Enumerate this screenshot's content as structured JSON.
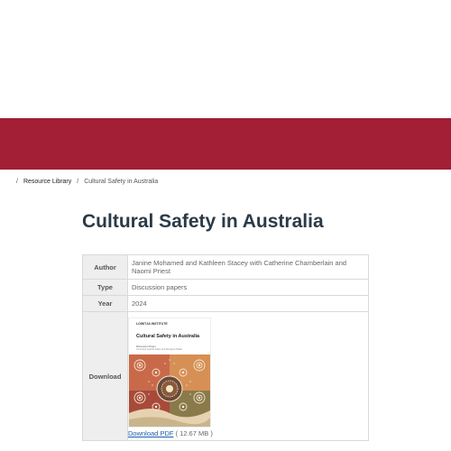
{
  "breadcrumb": {
    "separator": "/",
    "items": [
      "Resource Library",
      "Cultural Safety in Australia"
    ]
  },
  "page_title": "Cultural Safety in Australia",
  "details": {
    "author_label": "Author",
    "author_value": "Janine Mohamed and Kathleen Stacey with Catherine Chamberlain and Naomi Priest",
    "type_label": "Type",
    "type_value": "Discussion papers",
    "year_label": "Year",
    "year_value": "2024",
    "download_label": "Download",
    "cover": {
      "logo_text": "LOWITJA INSTITUTE",
      "title": "Cultural Safety in Australia",
      "subtitle": "Discussion Paper",
      "subtitle2": "Co-funded Cultural Safety and Aboriginal Health"
    },
    "download_link": "Download PDF",
    "file_size": "( 12.67 MB )"
  },
  "colors": {
    "banner": "#a21f35",
    "title": "#2b3a47",
    "link": "#1a5fa8"
  }
}
